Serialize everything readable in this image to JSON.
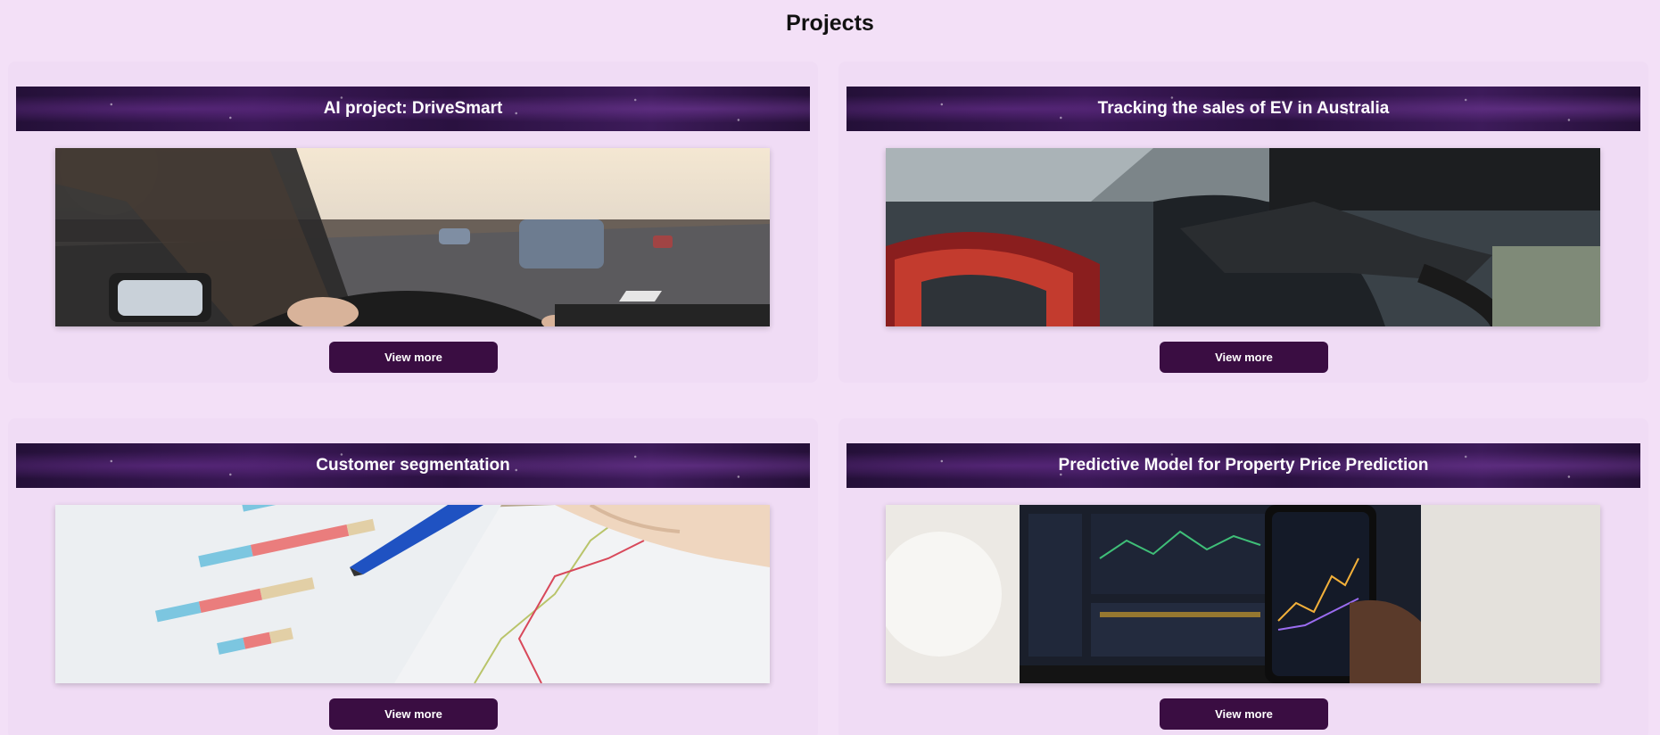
{
  "page": {
    "title": "Projects"
  },
  "projects": [
    {
      "title": "AI project: DriveSmart",
      "button_label": "View more",
      "image": "car-driving-highway-photo"
    },
    {
      "title": "Tracking the sales of EV in Australia",
      "button_label": "View more",
      "image": "ev-charging-plug-photo"
    },
    {
      "title": "Customer segmentation",
      "button_label": "View more",
      "image": "bar-chart-paper-pen-photo"
    },
    {
      "title": "Predictive Model for Property Price Prediction",
      "button_label": "View more",
      "image": "stock-charts-phone-laptop-photo"
    }
  ],
  "colors": {
    "page_bg": "#f3e0f7",
    "card_bg": "#f0dcf5",
    "button_bg": "#3a0d42",
    "banner_bg": "#2e1248"
  }
}
